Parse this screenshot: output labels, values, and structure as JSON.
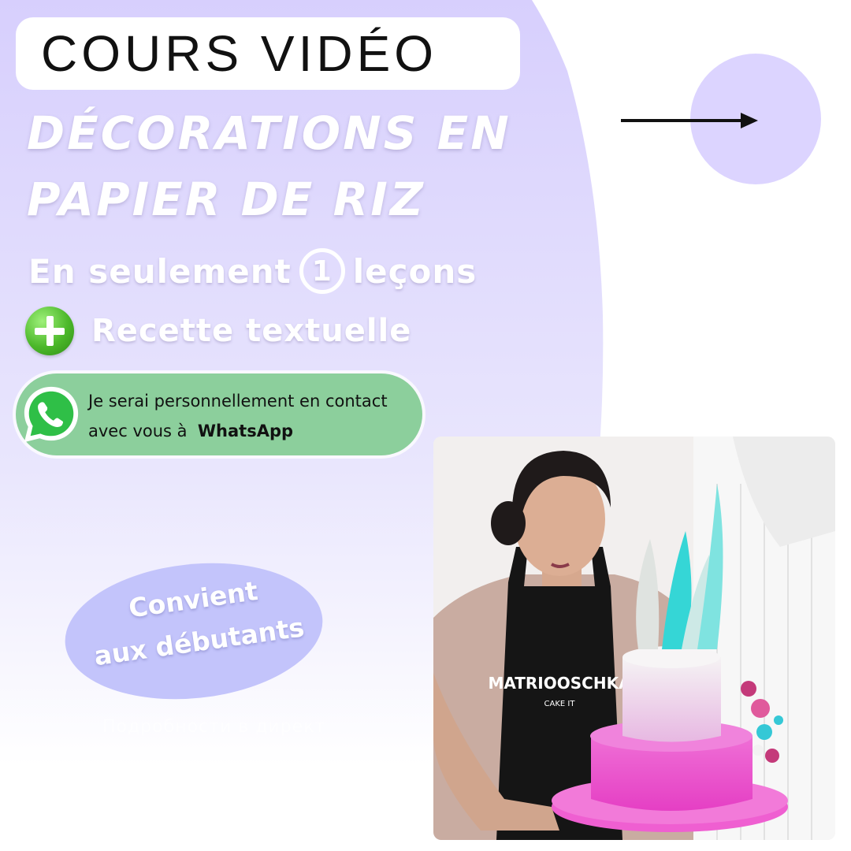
{
  "header": {
    "title": "COURS VIDÉO"
  },
  "headline": {
    "line1": "DÉCORATIONS EN",
    "line2": "PAPIER DE RIZ"
  },
  "lessons": {
    "prefix": "En seulement",
    "count": "1",
    "suffix": "leçons"
  },
  "bonus": {
    "label": "Recette textuelle",
    "icon": "plus-icon"
  },
  "whatsapp": {
    "icon": "whatsapp-icon",
    "line1": "Je serai personnellement en contact",
    "line2_prefix": "avec vous à",
    "line2_bold": "WhatsApp"
  },
  "badge": {
    "line1": "Convient",
    "line2": "aux débutants"
  },
  "ghost_text": "Подробности в директ",
  "photo": {
    "apron_brand": "MATRIOOSCHKA",
    "apron_sub": "CAKE IT"
  },
  "colors": {
    "lavender": "#d6cffd",
    "circle": "#dcd4ff",
    "whatsapp_pill": "#8ccf9c",
    "badge": "#c3c4fb",
    "cake_pink": "#ea44c6",
    "accent_teal": "#35d6d6"
  }
}
